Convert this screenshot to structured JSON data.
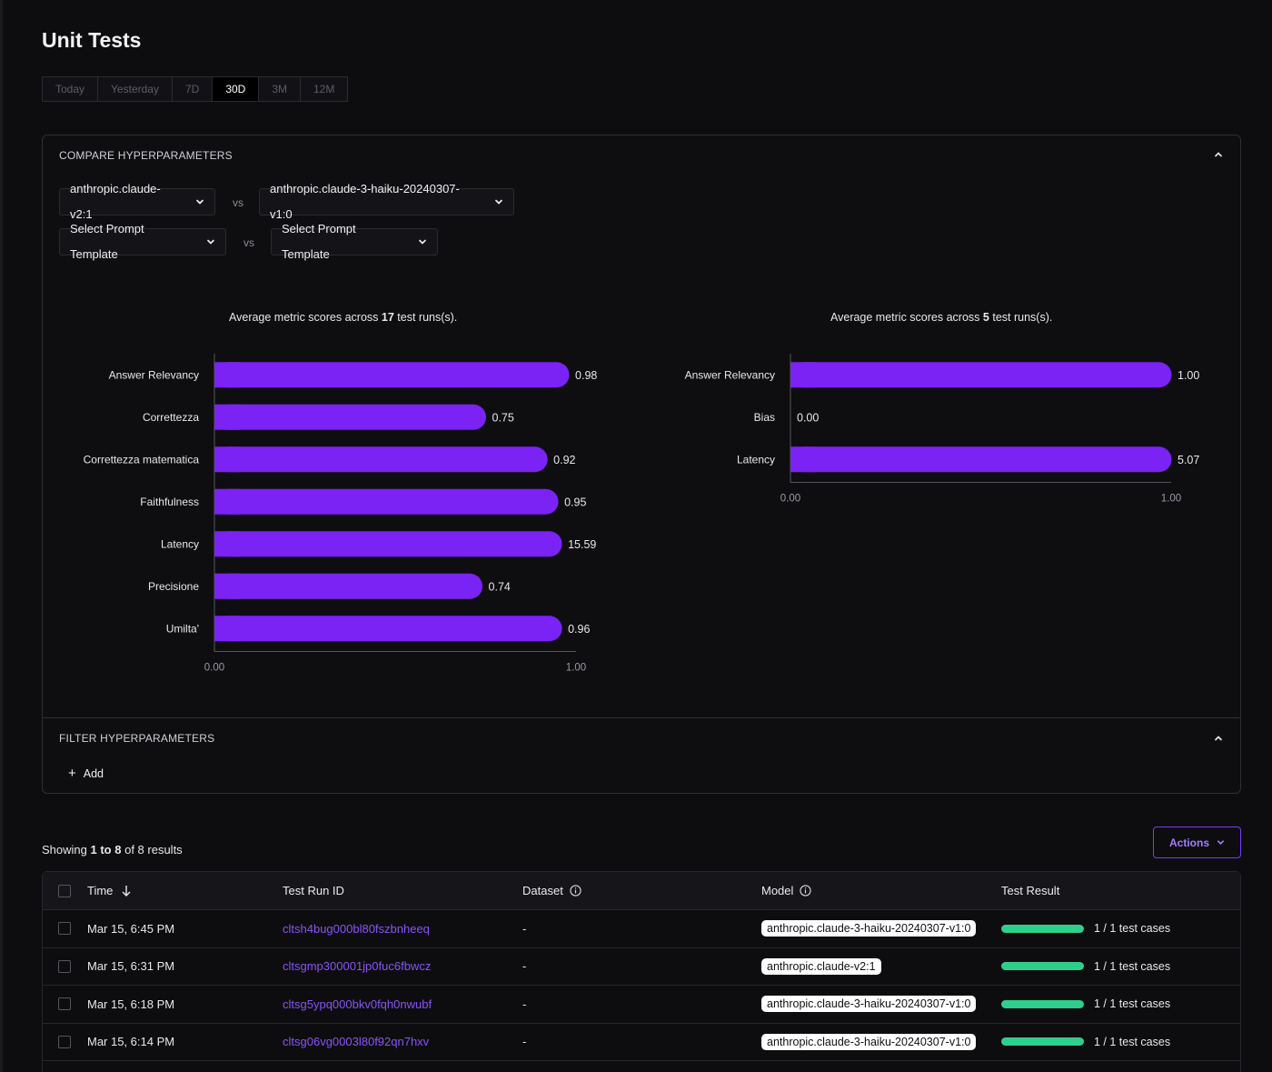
{
  "page": {
    "title": "Unit Tests"
  },
  "range_tabs": [
    {
      "label": "Today",
      "active": false
    },
    {
      "label": "Yesterday",
      "active": false
    },
    {
      "label": "7D",
      "active": false
    },
    {
      "label": "30D",
      "active": true
    },
    {
      "label": "3M",
      "active": false
    },
    {
      "label": "12M",
      "active": false
    }
  ],
  "compare": {
    "heading": "COMPARE HYPERPARAMETERS",
    "model_left": "anthropic.claude-v2:1",
    "model_right": "anthropic.claude-3-haiku-20240307-v1:0",
    "prompt_left": "Select Prompt Template",
    "prompt_right": "Select Prompt Template",
    "vs": "vs"
  },
  "filter": {
    "heading": "FILTER HYPERPARAMETERS",
    "add_label": "Add"
  },
  "chart_data": [
    {
      "type": "bar",
      "orientation": "horizontal",
      "title_prefix": "Average metric scores across",
      "runs": "17",
      "title_suffix": "test runs(s).",
      "categories": [
        "Answer Relevancy",
        "Correttezza",
        "Correttezza matematica",
        "Faithfulness",
        "Latency",
        "Precisione",
        "Umilta'"
      ],
      "values": [
        0.98,
        0.75,
        0.92,
        0.95,
        15.59,
        0.74,
        0.96
      ],
      "value_labels": [
        "0.98",
        "0.75",
        "0.92",
        "0.95",
        "15.59",
        "0.74",
        "0.96"
      ],
      "bar_fill": [
        0.98,
        0.75,
        0.92,
        0.95,
        0.96,
        0.74,
        0.96
      ],
      "xlim": [
        0,
        1
      ],
      "xticks": [
        "0.00",
        "1.00"
      ],
      "color": "#7b22f5"
    },
    {
      "type": "bar",
      "orientation": "horizontal",
      "title_prefix": "Average metric scores across",
      "runs": "5",
      "title_suffix": "test runs(s).",
      "categories": [
        "Answer Relevancy",
        "Bias",
        "Latency"
      ],
      "values": [
        1.0,
        0.0,
        5.07
      ],
      "value_labels": [
        "1.00",
        "0.00",
        "5.07"
      ],
      "bar_fill": [
        1.0,
        0.0,
        1.0
      ],
      "xlim": [
        0,
        1
      ],
      "xticks": [
        "0.00",
        "1.00"
      ],
      "color": "#7b22f5"
    }
  ],
  "results": {
    "showing_prefix": "Showing",
    "showing_range": "1 to 8",
    "showing_suffix": "of 8 results",
    "actions_label": "Actions"
  },
  "table": {
    "columns": {
      "time": "Time",
      "test_run_id": "Test Run ID",
      "dataset": "Dataset",
      "model": "Model",
      "test_result": "Test Result"
    },
    "rows": [
      {
        "time": "Mar 15, 6:45 PM",
        "id": "cltsh4bug000bl80fszbnheeq",
        "dataset": "-",
        "model": "anthropic.claude-3-haiku-20240307-v1:0",
        "result": "1 / 1 test cases",
        "pass_fraction": 1.0
      },
      {
        "time": "Mar 15, 6:31 PM",
        "id": "cltsgmp300001jp0fuc6fbwcz",
        "dataset": "-",
        "model": "anthropic.claude-v2:1",
        "result": "1 / 1 test cases",
        "pass_fraction": 1.0
      },
      {
        "time": "Mar 15, 6:18 PM",
        "id": "cltsg5ypq000bkv0fqh0nwubf",
        "dataset": "-",
        "model": "anthropic.claude-3-haiku-20240307-v1:0",
        "result": "1 / 1 test cases",
        "pass_fraction": 1.0
      },
      {
        "time": "Mar 15, 6:14 PM",
        "id": "cltsg06vg0003l80f92qn7hxv",
        "dataset": "-",
        "model": "anthropic.claude-3-haiku-20240307-v1:0",
        "result": "1 / 1 test cases",
        "pass_fraction": 1.0
      }
    ]
  },
  "colors": {
    "accent": "#7b22f5",
    "link": "#8a52f5",
    "success": "#2ecf8c",
    "background": "#0d0d10"
  }
}
